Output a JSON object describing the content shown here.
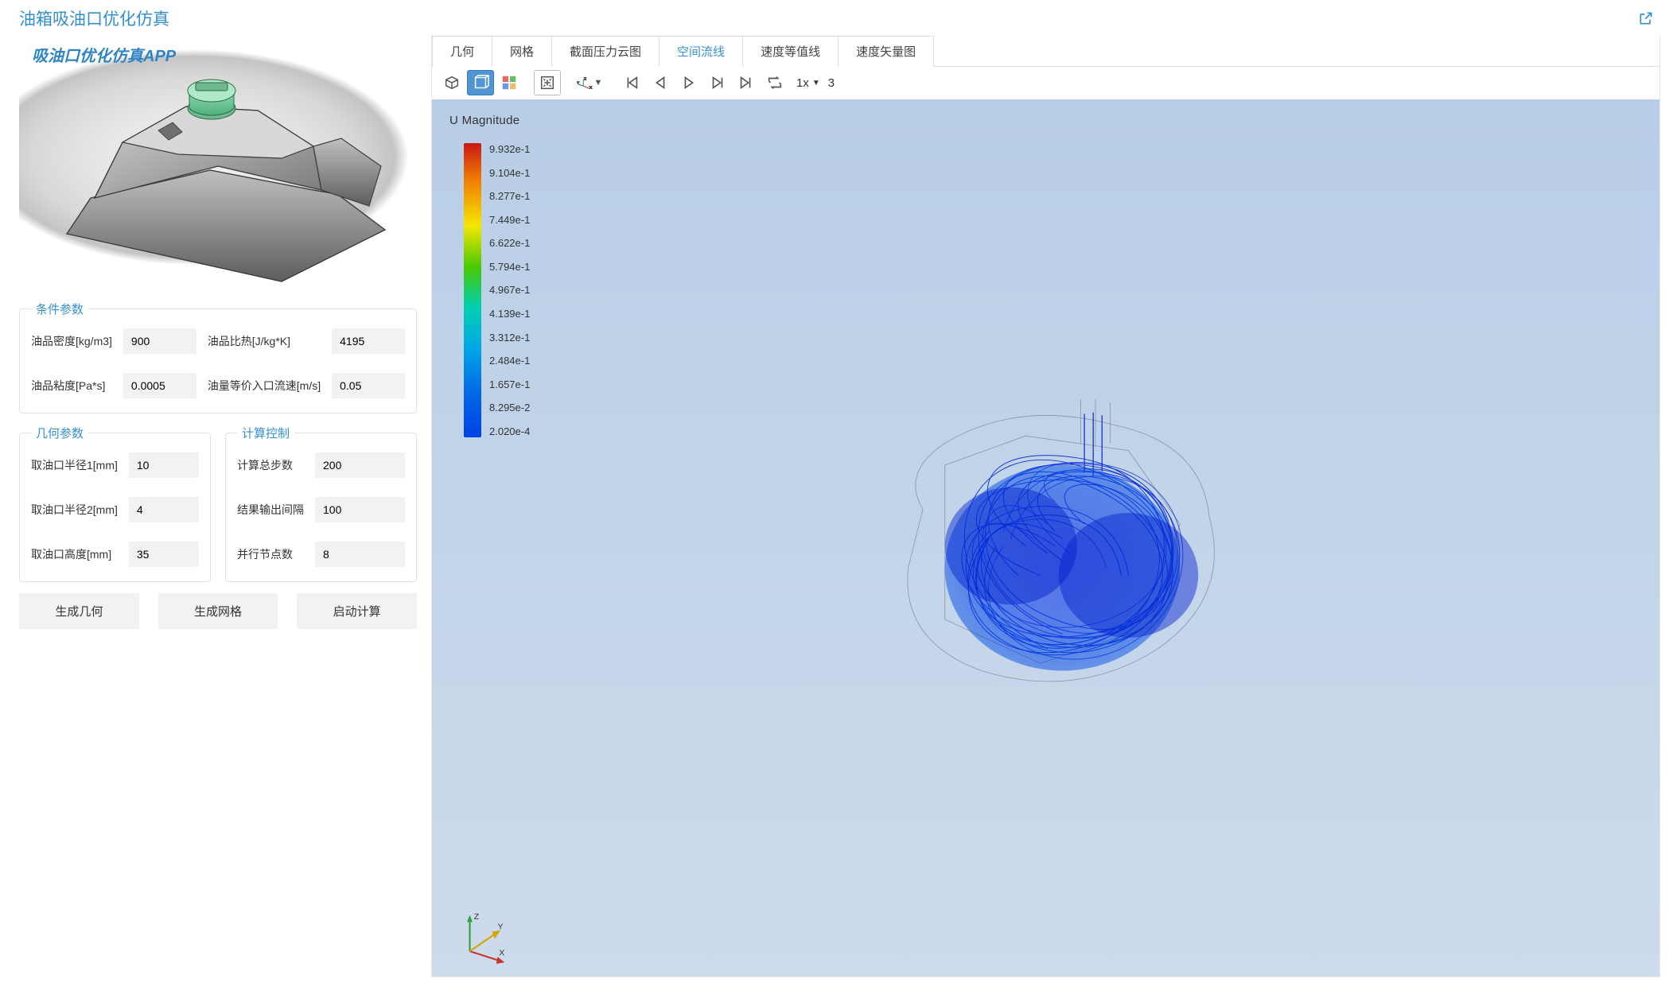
{
  "header": {
    "title": "油箱吸油口优化仿真"
  },
  "thumb": {
    "caption": "吸油口优化仿真APP"
  },
  "sections": {
    "conditions": {
      "legend": "条件参数",
      "density_label": "油品密度[kg/m3]",
      "density": "900",
      "specificheat_label": "油品比热[J/kg*K]",
      "specificheat": "4195",
      "viscosity_label": "油品粘度[Pa*s]",
      "viscosity": "0.0005",
      "inletvel_label": "油量等价入口流速[m/s]",
      "inletvel": "0.05"
    },
    "geometry": {
      "legend": "几何参数",
      "r1_label": "取油口半径1[mm]",
      "r1": "10",
      "r2_label": "取油口半径2[mm]",
      "r2": "4",
      "h_label": "取油口高度[mm]",
      "h": "35"
    },
    "compute": {
      "legend": "计算控制",
      "steps_label": "计算总步数",
      "steps": "200",
      "out_label": "结果输出间隔",
      "out": "100",
      "para_label": "并行节点数",
      "para": "8"
    }
  },
  "actions": {
    "gen_geom": "生成几何",
    "gen_mesh": "生成网格",
    "start": "启动计算"
  },
  "tabs": [
    "几何",
    "网格",
    "截面压力云图",
    "空间流线",
    "速度等值线",
    "速度矢量图"
  ],
  "active_tab": 3,
  "playback": {
    "speed_label": "1x",
    "frame": "3"
  },
  "legend": {
    "title": "U Magnitude",
    "ticks": [
      "9.932e-1",
      "9.104e-1",
      "8.277e-1",
      "7.449e-1",
      "6.622e-1",
      "5.794e-1",
      "4.967e-1",
      "4.139e-1",
      "3.312e-1",
      "2.484e-1",
      "1.657e-1",
      "8.295e-2",
      "2.020e-4"
    ]
  },
  "axes": [
    "X",
    "Y",
    "Z"
  ]
}
